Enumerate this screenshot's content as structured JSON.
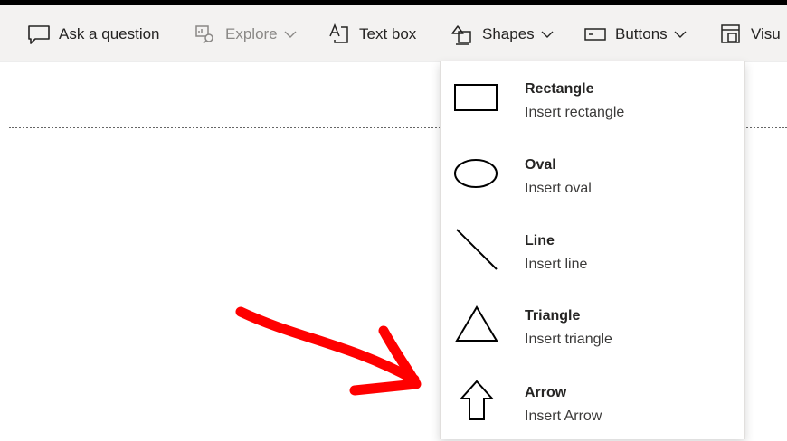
{
  "toolbar": {
    "items": [
      {
        "label": "Ask a question",
        "icon": "speech-bubble-icon",
        "disabled": false
      },
      {
        "label": "Explore",
        "icon": "explore-icon",
        "disabled": true
      },
      {
        "label": "Text box",
        "icon": "text-box-icon",
        "disabled": false
      },
      {
        "label": "Shapes",
        "icon": "shapes-icon",
        "disabled": false
      },
      {
        "label": "Buttons",
        "icon": "buttons-icon",
        "disabled": false
      },
      {
        "label": "Visu",
        "icon": "visual-icon",
        "disabled": false
      }
    ]
  },
  "shapes_menu": {
    "items": [
      {
        "title": "Rectangle",
        "subtitle": "Insert rectangle",
        "icon": "rectangle-icon"
      },
      {
        "title": "Oval",
        "subtitle": "Insert oval",
        "icon": "oval-icon"
      },
      {
        "title": "Line",
        "subtitle": "Insert line",
        "icon": "line-icon"
      },
      {
        "title": "Triangle",
        "subtitle": "Insert triangle",
        "icon": "triangle-icon"
      },
      {
        "title": "Arrow",
        "subtitle": "Insert Arrow",
        "icon": "arrow-up-icon"
      }
    ]
  },
  "colors": {
    "toolbar_bg": "#f3f2f1",
    "annotation": "#ff0000",
    "disabled_text": "#8a8886"
  }
}
